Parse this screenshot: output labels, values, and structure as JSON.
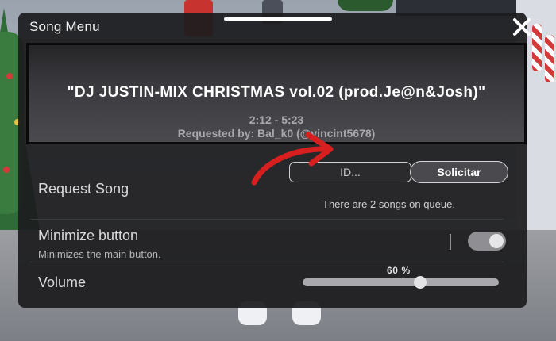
{
  "menu": {
    "title": "Song Menu"
  },
  "now_playing": {
    "song_title": "\"DJ JUSTIN-MIX CHRISTMAS vol.02 (prod.Je@n&Josh)\"",
    "time": "2:12 - 5:23",
    "requested_by": "Requested by: Bal_k0 (@vincint5678)"
  },
  "request_song": {
    "label": "Request Song",
    "id_placeholder": "ID...",
    "id_value": "",
    "button_label": "Solicitar",
    "queue_info": "There are 2 songs on queue."
  },
  "minimize": {
    "label": "Minimize button",
    "description": "Minimizes the main button.",
    "enabled": true
  },
  "volume": {
    "label": "Volume",
    "value_text": "60 %",
    "level": 0.6
  },
  "colors": {
    "panel_bg": "#1c1c1e",
    "arrow": "#d81f1f",
    "toggle_on": "#8e8e93"
  },
  "icons": {
    "close": "close-icon"
  }
}
